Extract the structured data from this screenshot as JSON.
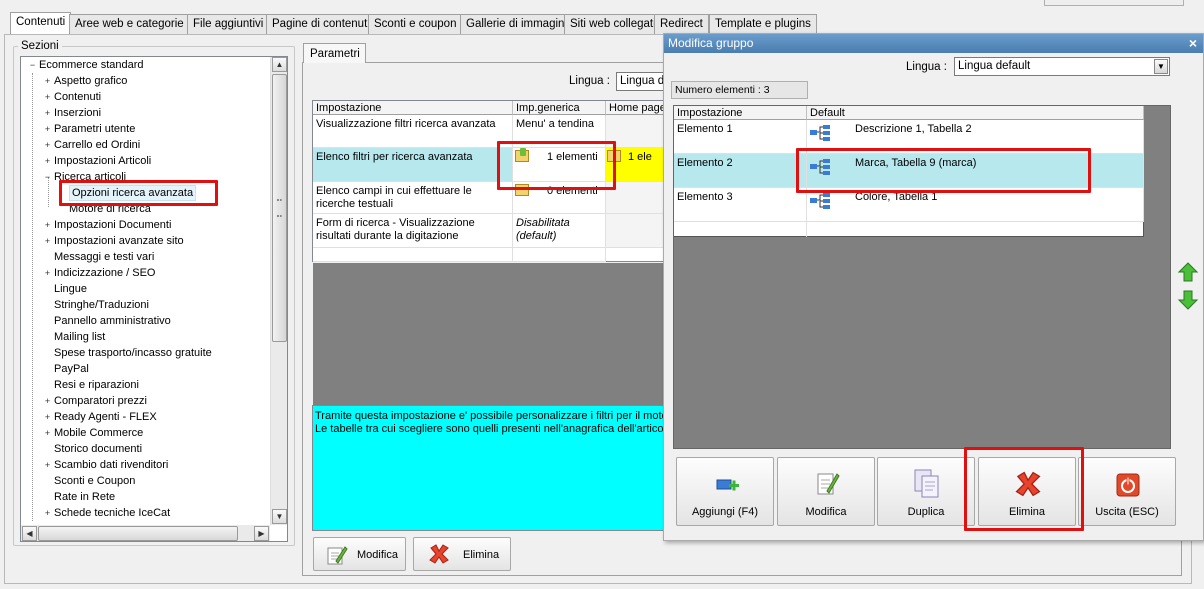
{
  "tabs": [
    "Contenuti",
    "Aree web e categorie",
    "File aggiuntivi",
    "Pagine di contenuti",
    "Sconti e coupon",
    "Gallerie di immagini",
    "Siti web collegati",
    "Redirect",
    "Template e plugins"
  ],
  "sidebar": {
    "legend": "Sezioni",
    "items": [
      {
        "label": "Ecommerce standard",
        "expander": "−"
      },
      {
        "label": "Aspetto grafico",
        "expander": "+"
      },
      {
        "label": "Contenuti",
        "expander": "+"
      },
      {
        "label": "Inserzioni",
        "expander": "+"
      },
      {
        "label": "Parametri utente",
        "expander": "+"
      },
      {
        "label": "Carrello ed Ordini",
        "expander": "+"
      },
      {
        "label": "Impostazioni Articoli",
        "expander": "+"
      },
      {
        "label": "Ricerca articoli",
        "expander": "−"
      },
      {
        "label": "Opzioni ricerca avanzata",
        "expander": ""
      },
      {
        "label": "Motore di ricerca",
        "expander": ""
      },
      {
        "label": "Impostazioni Documenti",
        "expander": "+"
      },
      {
        "label": "Impostazioni avanzate sito",
        "expander": "+"
      },
      {
        "label": "Messaggi e testi vari",
        "expander": ""
      },
      {
        "label": "Indicizzazione / SEO",
        "expander": "+"
      },
      {
        "label": "Lingue",
        "expander": ""
      },
      {
        "label": "Stringhe/Traduzioni",
        "expander": ""
      },
      {
        "label": "Pannello amministrativo",
        "expander": ""
      },
      {
        "label": "Mailing list",
        "expander": ""
      },
      {
        "label": "Spese trasporto/incasso gratuite",
        "expander": ""
      },
      {
        "label": "PayPal",
        "expander": ""
      },
      {
        "label": "Resi e riparazioni",
        "expander": ""
      },
      {
        "label": "Comparatori prezzi",
        "expander": "+"
      },
      {
        "label": "Ready Agenti - FLEX",
        "expander": "+"
      },
      {
        "label": "Mobile Commerce",
        "expander": "+"
      },
      {
        "label": "Storico documenti",
        "expander": ""
      },
      {
        "label": "Scambio dati rivenditori",
        "expander": "+"
      },
      {
        "label": "Sconti e Coupon",
        "expander": ""
      },
      {
        "label": "Rate in Rete",
        "expander": ""
      },
      {
        "label": "Schede tecniche IceCat",
        "expander": "+"
      }
    ],
    "scroll_up": "▲",
    "scroll_down": "▼",
    "scroll_left": "◀",
    "scroll_right": "▶"
  },
  "params": {
    "tab_label": "Parametri",
    "lingua_label": "Lingua :",
    "lingua_value": "Lingua de",
    "headers": [
      "Impostazione",
      "Imp.generica",
      "Home page"
    ],
    "rows": [
      {
        "setting": "Visualizzazione filtri ricerca avanzata",
        "value": "Menu' a tendina",
        "home": ""
      },
      {
        "setting": "Elenco filtri per ricerca avanzata",
        "value": "1 elementi",
        "home": "1 ele"
      },
      {
        "setting": "Elenco campi in cui effettuare le ricerche testuali",
        "value": "0 elementi",
        "home": ""
      },
      {
        "setting": "Form di ricerca - Visualizzazione risultati durante la digitazione",
        "value": "Disabilitata (default)",
        "home": ""
      }
    ],
    "description_line1": "Tramite questa impostazione e' possibile personalizzare i filtri per il motore",
    "description_line2": "Le tabelle tra cui scegliere sono quelli presenti nell'anagrafica dell'articolo",
    "btn_modifica": "Modifica",
    "btn_elimina": "Elimina"
  },
  "dialog": {
    "title": "Modifica gruppo",
    "close": "×",
    "lingua_label": "Lingua :",
    "lingua_value": "Lingua default",
    "count_label": "Numero elementi : 3",
    "headers": [
      "Impostazione",
      "Default"
    ],
    "rows": [
      {
        "name": "Elemento 1",
        "value": "Descrizione 1, Tabella 2"
      },
      {
        "name": "Elemento 2",
        "value": "Marca, Tabella 9 (marca)"
      },
      {
        "name": "Elemento 3",
        "value": "Colore, Tabella 1"
      }
    ],
    "buttons": {
      "add": "Aggiungi (F4)",
      "edit": "Modifica",
      "dup": "Duplica",
      "del": "Elimina",
      "exit": "Uscita (ESC)"
    }
  },
  "colors": {
    "accent_red": "#e01010",
    "selected_row": "#b6e8ee",
    "description_bg": "#00ffff",
    "home_highlight": "#ffff00"
  }
}
